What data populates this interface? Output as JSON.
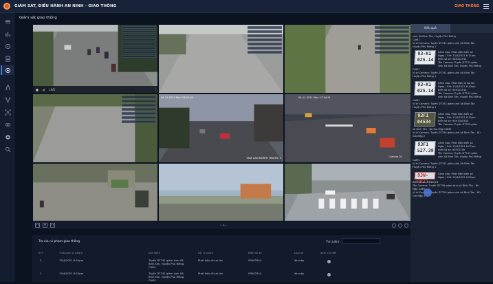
{
  "app": {
    "title": "GIÁM SÁT, ĐIỀU HÀNH AN NINH - GIAO THÔNG",
    "module": "GIAO THÔNG"
  },
  "page": {
    "title": "Giám sát giao thông"
  },
  "sidebar": {
    "icons": [
      "chart-icon",
      "radar-icon",
      "list-icon",
      "target-icon",
      "road-icon",
      "network-icon",
      "face-scan-icon",
      "link-icon",
      "record-icon",
      "search-icon"
    ],
    "active_index": 3
  },
  "cameras": [
    {
      "name": "camera-1",
      "palette": "street-trees",
      "control_text": "LIVE"
    },
    {
      "name": "camera-2",
      "palette": "empty-road"
    },
    {
      "name": "camera-3",
      "palette": "tree-road"
    },
    {
      "name": "camera-4",
      "palette": "empty-road-grey"
    },
    {
      "name": "camera-5",
      "palette": "dusk-street",
      "stamp": "04-11-2021 Mon 18:00:00",
      "label": "VIVA CAM NORTH TRAFFIC 1"
    },
    {
      "name": "camera-6",
      "palette": "night-intersection",
      "stamp": "04-11-2021 Mon 17:54:51",
      "label": "Camera 01"
    },
    {
      "name": "camera-7",
      "palette": "busy-street"
    },
    {
      "name": "camera-8",
      "palette": "sky-town"
    },
    {
      "name": "camera-9",
      "palette": "crosswalk"
    }
  ],
  "grid_bar": {
    "center": "‹ ⌂ ›"
  },
  "table": {
    "title": "Tra cứu vi phạm giao thông",
    "search_label": "Tìm kiếm:",
    "headers": [
      "STT",
      "Thời gian vi phạm",
      "Địa điểm",
      "Lỗi vi phạm",
      "Biển số xe",
      "Loại xe",
      "Xem chi tiết"
    ],
    "rows": [
      {
        "stt": "2",
        "time": "13/4/2021 6:10pm",
        "place": "Tuyến DT741 giám sinh Xã Bình Tân, Huyện Phú Riềng CAM1",
        "violation": "Phát hiện đi sai làn",
        "plate": "93K02514",
        "type": "Xe máy"
      },
      {
        "stt": "1",
        "time": "13/4/2021 6:10pm",
        "place": "Tuyến DT741 giám sinh Xã Bình Tân, Huyện Phú Riềng CAM1",
        "violation": "Phát hiện đi sai làn",
        "plate": "93K02514",
        "type": "Xe máy"
      }
    ]
  },
  "panel": {
    "tab": "Kết quả",
    "top_text": [
      "sinh Xã Bình Tân, Huyện Phú Riềng",
      "CAM1",
      "Vị trí Camera: Tuyến DT741 giám sinh Xã Bình Tân",
      "Huyện Phú Riềng 1"
    ],
    "cards": [
      {
        "plate_l1": "93-K1",
        "plate_l2": "025.14",
        "style": "white",
        "lines": [
          "Cảnh báo: Phát hiện biển số",
          "Ngày / Giờ: 13/4/2021 6:11pm",
          "Biển số xe: 93K102514",
          "Tên Camera: Tuyến DT741 giám",
          "sinh Xã Bình Tân, Huyện Phú Riềng"
        ],
        "after": [
          "CAM1",
          "Vị trí Camera: Tuyến DT741 giám sinh Xã Bình Tân",
          "Huyện Phú Riềng 1"
        ]
      },
      {
        "plate_l1": "93-K1",
        "plate_l2": "025.14",
        "style": "white",
        "lines": [
          "Cảnh báo: Phát hiện đi sai làn",
          "Ngày / Giờ: 13/4/2021 6:10pm",
          "Biển số xe: 93K102514",
          "Tên Camera: Tuyến DT741 giám",
          "sinh Xã Bình Tân, Huyện Phú Riềng"
        ],
        "after": [
          "CAM1",
          "Vị trí Camera: Tuyến DT741 giám sinh Xã Bình Tân",
          "Huyện Phú Riềng 1"
        ]
      },
      {
        "plate_l1": "93F1",
        "plate_l2": "04534",
        "style": "dark",
        "lines": [
          "Cảnh báo: Phát hiện biển số",
          "Ngày / Giờ: 13/4/2021 6:10pm",
          "Biển số xe: 93H1045343",
          "Tên Camera: Tuyến DT759 giám"
        ],
        "after": [
          "xã Bình Tân - Bù Gia Mập CAM2",
          "Vị trí Camera: Tuyến DT759 giám sinh xã Bình Tân - Bù",
          "Gia Mập 2"
        ]
      },
      {
        "plate_l1": "93F1",
        "plate_l2": "527.39",
        "style": "white",
        "lines": [
          "Cảnh báo: Phát hiện biển số",
          "Ngày / Giờ: 13/4/2021 6:07pm",
          "Biển số xe: 93F52739",
          "Tên Camera: Tuyến DT741 giám",
          "sinh Xã Bình Tân, Huyện Phú Riềng"
        ],
        "after": [
          "CAM1",
          "Vị trí Camera: Tuyến DT741 giám sinh Xã Bình Tân",
          "Huyện Phú Riềng 1"
        ]
      },
      {
        "plate_l1": "93N-0023",
        "plate_l2": "",
        "style": "red",
        "lines": [
          "Cảnh báo: Phát hiện biển số",
          "Ngày / Giờ: 13/4/2021 6:05pm"
        ],
        "after": [
          "Biển số xe: 93N0023",
          "Tên Camera: Tuyến DT759 giám sinh xã Bình Tân - Bù",
          "Mập CAM1",
          "Vị trí Camera: Tuyến DT759 giám sinh xã Bình Tân - Bù",
          "Gia Mập 1"
        ]
      }
    ]
  },
  "colors": {
    "accent": "#ff7a3c",
    "bg": "#0b1220",
    "panel": "#1a2232",
    "sidebar": "#141d30"
  }
}
